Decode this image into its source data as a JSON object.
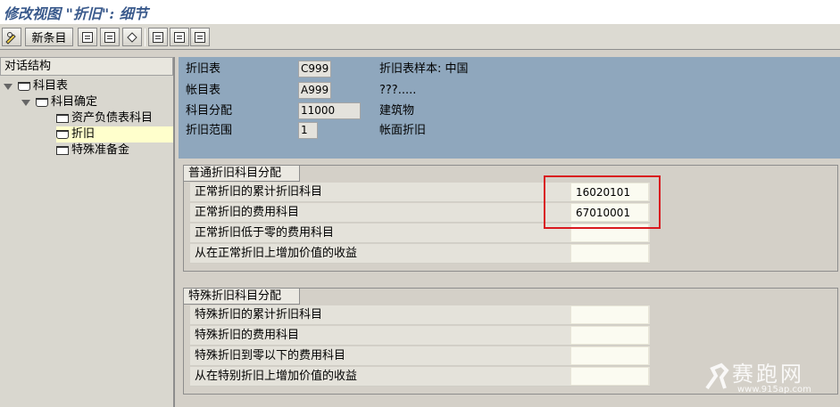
{
  "window": {
    "title": "修改视图 \"折旧\": 细节"
  },
  "toolbar": {
    "new_entries_label": "新条目"
  },
  "tree": {
    "header": "对话结构",
    "items": [
      {
        "label": "科目表"
      },
      {
        "label": "科目确定"
      },
      {
        "label": "资产负债表科目"
      },
      {
        "label": "折旧"
      },
      {
        "label": "特殊准备金"
      }
    ]
  },
  "header_fields": [
    {
      "label": "折旧表",
      "value": "C999",
      "desc": "折旧表样本: 中国"
    },
    {
      "label": "帐目表",
      "value": "A999",
      "desc": "???....."
    },
    {
      "label": "科目分配",
      "value": "11000",
      "desc": "建筑物"
    },
    {
      "label": "折旧范围",
      "value": "1",
      "desc": "帐面折旧"
    }
  ],
  "groups": [
    {
      "title": "普通折旧科目分配",
      "rows": [
        {
          "label": "正常折旧的累计折旧科目",
          "value": "16020101"
        },
        {
          "label": "正常折旧的费用科目",
          "value": "67010001"
        },
        {
          "label": "正常折旧低于零的费用科目",
          "value": ""
        },
        {
          "label": "从在正常折旧上增加价值的收益",
          "value": ""
        }
      ]
    },
    {
      "title": "特殊折旧科目分配",
      "rows": [
        {
          "label": "特殊折旧的累计折旧科目",
          "value": ""
        },
        {
          "label": "特殊折旧的费用科目",
          "value": ""
        },
        {
          "label": "特殊折旧到零以下的费用科目",
          "value": ""
        },
        {
          "label": "从在特别折旧上增加价值的收益",
          "value": ""
        }
      ]
    }
  ],
  "watermark": {
    "text": "赛跑网",
    "url": "www.915ap.com"
  }
}
